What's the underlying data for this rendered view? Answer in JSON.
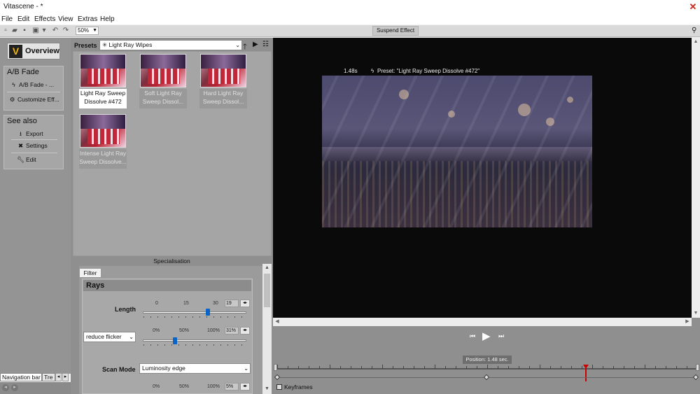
{
  "window": {
    "title": "Vitascene - *",
    "close_glyph": "✕"
  },
  "menu": [
    "File",
    "Edit",
    "Effects",
    "View",
    "Extras",
    "Help"
  ],
  "toolbar": {
    "zoom": "50%",
    "suspend_label": "Suspend Effect"
  },
  "left": {
    "overview_label": "Overview",
    "ab_section_title": "A/B Fade",
    "ab_button": "A/B Fade - ...",
    "customize_button": "Customize Eff...",
    "see_also_title": "See also",
    "see_also_items": [
      "Export",
      "Settings",
      "Edit"
    ],
    "nav_tab": "Navigation bar",
    "nav_tab2": "Tre"
  },
  "presets": {
    "label": "Presets",
    "category": "Light Ray Wipes",
    "items": [
      {
        "line1": "Light Ray Sweep",
        "line2": "Dissolve #472",
        "selected": true
      },
      {
        "line1": "Soft Light Ray",
        "line2": "Sweep Dissol...",
        "selected": false
      },
      {
        "line1": "Hard Light Ray",
        "line2": "Sweep Dissol...",
        "selected": false
      },
      {
        "line1": "Intense Light Ray",
        "line2": "Sweep Dissolve...",
        "selected": false
      }
    ]
  },
  "specialisation": {
    "label": "Specialisation",
    "filter_tab": "Filter",
    "section": "Rays",
    "length": {
      "label": "Length",
      "ticks": [
        "0",
        "15",
        "30"
      ],
      "value": "19",
      "fraction": 0.63
    },
    "flicker": {
      "mode": "reduce flicker",
      "ticks": [
        "0%",
        "50%",
        "100%"
      ],
      "value": "31%",
      "fraction": 0.31
    },
    "scan_mode": {
      "label": "Scan Mode",
      "value": "Luminosity edge"
    },
    "threshold": {
      "ticks": [
        "0%",
        "50%",
        "100%"
      ],
      "value": "5%"
    }
  },
  "preview": {
    "time": "1.48s",
    "preset_text": "Preset: \"Light Ray Sweep Dissolve #472\"",
    "position": "Position: 1.48 sec.",
    "keyframes_label": "Keyframes",
    "playhead_fraction": 0.735
  },
  "colors": {
    "accent_blue": "#0a64c8",
    "marker_red": "#cc0000",
    "panel_gray": "#8f8f8f"
  }
}
